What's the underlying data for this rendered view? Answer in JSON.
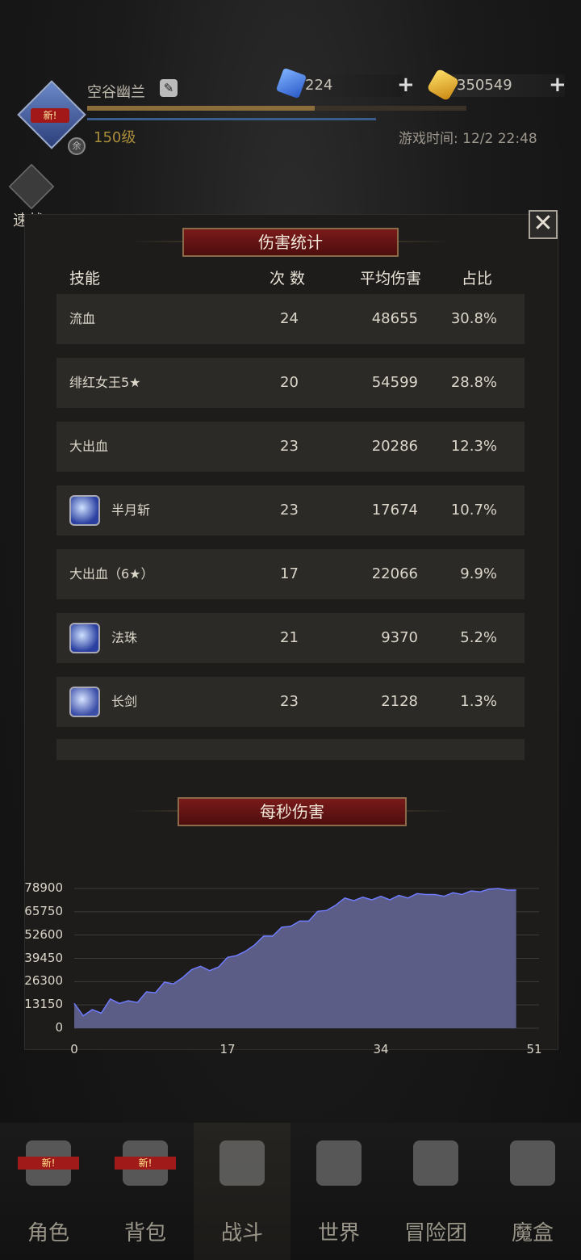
{
  "header": {
    "player_name": "空谷幽兰",
    "avatar_badge": "新!",
    "level": "150级",
    "gems": "224",
    "gold": "350549",
    "game_time": "游戏时间: 12/2 22:48",
    "quick_battle": "速战",
    "exp_fraction": 0.6
  },
  "panel": {
    "damage_title": "伤害统计",
    "dps_title": "每秒伤害",
    "close": "✕",
    "columns": {
      "skill": "技能",
      "count": "次 数",
      "avg": "平均伤害",
      "ratio": "占比"
    },
    "rows": [
      {
        "skill": "流血",
        "count": "24",
        "avg": "48655",
        "ratio": "30.8%"
      },
      {
        "skill": "绯红女王5★",
        "count": "20",
        "avg": "54599",
        "ratio": "28.8%"
      },
      {
        "skill": "大出血",
        "count": "23",
        "avg": "20286",
        "ratio": "12.3%"
      },
      {
        "skill": "半月斩",
        "count": "23",
        "avg": "17674",
        "ratio": "10.7%",
        "icon": "crescent-moon-icon"
      },
      {
        "skill": "大出血（6★）",
        "count": "17",
        "avg": "22066",
        "ratio": "9.9%"
      },
      {
        "skill": "法珠",
        "count": "21",
        "avg": "9370",
        "ratio": "5.2%",
        "icon": "magic-orb-icon"
      },
      {
        "skill": "长剑",
        "count": "23",
        "avg": "2128",
        "ratio": "1.3%",
        "icon": "sword-icon"
      }
    ]
  },
  "chart_data": {
    "type": "area",
    "title": "每秒伤害",
    "x_ticks": [
      "0",
      "17",
      "34",
      "51"
    ],
    "y_ticks": [
      "78900",
      "65750",
      "52600",
      "39450",
      "26300",
      "13150",
      "0"
    ],
    "xlim": [
      0,
      51
    ],
    "ylim": [
      0,
      78900
    ],
    "fill_color": "#5b5d86",
    "line_color": "#6f7cff",
    "x": [
      0,
      1,
      2,
      3,
      4,
      5,
      6,
      7,
      8,
      9,
      10,
      11,
      12,
      13,
      14,
      15,
      16,
      17,
      18,
      19,
      20,
      21,
      22,
      23,
      24,
      25,
      26,
      27,
      28,
      29,
      30,
      31,
      32,
      33,
      34,
      35,
      36,
      37,
      38,
      39,
      40,
      41,
      42,
      43,
      44,
      45,
      46,
      47,
      48,
      49
    ],
    "values": [
      14000,
      7000,
      10500,
      8500,
      16500,
      14000,
      15500,
      14500,
      20500,
      20000,
      26000,
      25000,
      28500,
      33000,
      35000,
      32500,
      34500,
      40000,
      41000,
      43500,
      47000,
      52000,
      52000,
      57000,
      57500,
      60500,
      60500,
      66000,
      66500,
      69500,
      73500,
      72000,
      74000,
      72500,
      74500,
      72500,
      75000,
      73500,
      76000,
      75500,
      75500,
      74500,
      76500,
      75500,
      77500,
      77000,
      78500,
      78900,
      78000,
      78000
    ]
  },
  "nav": [
    {
      "label": "角色",
      "icon": "helmet-icon",
      "badge": "新!"
    },
    {
      "label": "背包",
      "icon": "backpack-icon",
      "badge": "新!"
    },
    {
      "label": "战斗",
      "icon": "shield-sword-icon",
      "active": true
    },
    {
      "label": "世界",
      "icon": "map-scroll-icon"
    },
    {
      "label": "冒险团",
      "icon": "castle-icon"
    },
    {
      "label": "魔盒",
      "icon": "magic-cube-icon"
    }
  ]
}
